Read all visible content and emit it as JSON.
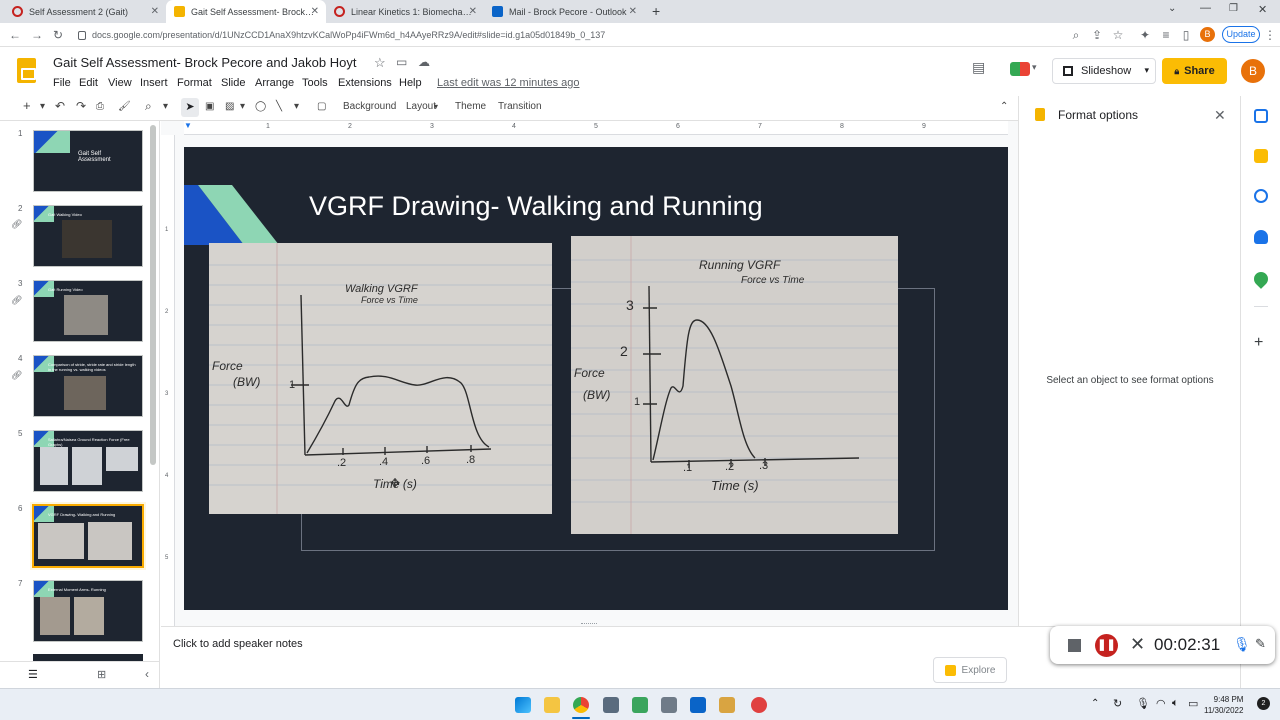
{
  "browser": {
    "tabs": [
      {
        "label": "Self Assessment 2 (Gait)",
        "active": false
      },
      {
        "label": "Gait Self Assessment- Brock Pec...",
        "active": true
      },
      {
        "label": "Linear Kinetics 1: Biomechanics",
        "active": false
      },
      {
        "label": "Mail - Brock Pecore - Outlook",
        "active": false
      }
    ],
    "url": "docs.google.com/presentation/d/1UNzCCD1AnaX9htzvKCalWoPp4iFWm6d_h4AAyeRRz9A/edit#slide=id.g1a05d01849b_0_137",
    "update_label": "Update",
    "profile_initial": "B"
  },
  "docs": {
    "title": "Gait Self Assessment- Brock Pecore and Jakob Hoyt",
    "menus": [
      "File",
      "Edit",
      "View",
      "Insert",
      "Format",
      "Slide",
      "Arrange",
      "Tools",
      "Extensions",
      "Help"
    ],
    "last_edit": "Last edit was 12 minutes ago",
    "slideshow_label": "Slideshow",
    "share_label": "Share",
    "account_initial": "B"
  },
  "toolbar": {
    "background": "Background",
    "layout": "Layout",
    "theme": "Theme",
    "transition": "Transition"
  },
  "ruler": [
    "1",
    "1",
    "2",
    "3",
    "4",
    "5",
    "6",
    "7",
    "8",
    "9"
  ],
  "vruler": [
    "1",
    "2",
    "3",
    "4",
    "5"
  ],
  "filmstrip": [
    {
      "num": "1",
      "title": "Gait Self Assessment",
      "linked": false
    },
    {
      "num": "2",
      "title": "Gait Walking Video",
      "linked": true
    },
    {
      "num": "3",
      "title": "Gait Running Video",
      "linked": true
    },
    {
      "num": "4",
      "title": "Comparison of stride, stride rate and stride length in the running vs. walking videos",
      "linked": true
    },
    {
      "num": "5",
      "title": "Saliahra/Naisea Ground Reaction Force (Free Graphs)",
      "linked": false
    },
    {
      "num": "6",
      "title": "VGRF Drawing- Walking and Running",
      "linked": false
    },
    {
      "num": "7",
      "title": "External Moment Arms- Running",
      "linked": false
    }
  ],
  "slide": {
    "title": "VGRF Drawing- Walking and Running",
    "walking": {
      "heading": "Walking VGRF",
      "subheading": "Force vs Time",
      "ylabel_1": "Force",
      "ylabel_2": "(BW)",
      "ytick": "1",
      "xticks": [
        ".2",
        ".4",
        ".6",
        ".8"
      ],
      "xlabel": "Time (s)"
    },
    "running": {
      "heading": "Running VGRF",
      "subheading": "Force vs Time",
      "ylabel_1": "Force",
      "ylabel_2": "(BW)",
      "yticks": [
        "3",
        "2",
        "1"
      ],
      "xticks": [
        ".1",
        ".2",
        ".3"
      ],
      "xlabel": "Time (s)"
    }
  },
  "format_panel": {
    "title": "Format options",
    "message": "Select an object to see format options"
  },
  "notes": {
    "placeholder": "Click to add speaker notes",
    "explore_label": "Explore"
  },
  "recorder": {
    "time": "00:02:31"
  },
  "clock": {
    "time": "9:48 PM",
    "date": "11/30/2022"
  },
  "colors": {
    "slide_bg": "#1e2530",
    "share_yellow": "#fbbc04",
    "accent_blue": "#1a53c5",
    "accent_green": "#8ed6b4"
  }
}
